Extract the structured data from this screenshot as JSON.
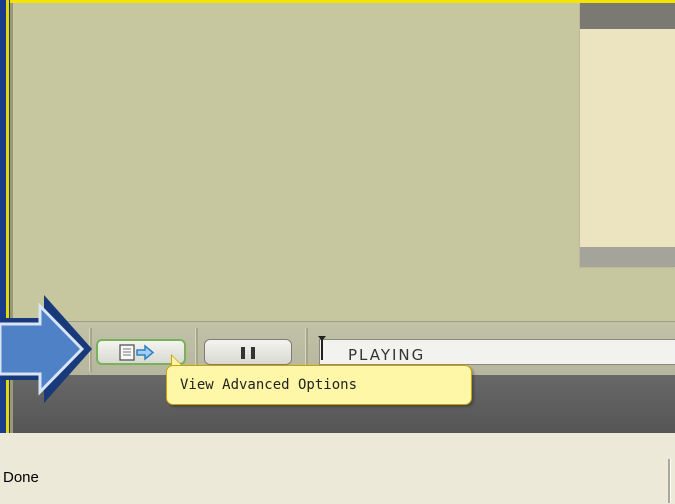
{
  "controlbar": {
    "advanced_button_tooltip": "View Advanced Options",
    "pause_button": "pause",
    "status_field": "PLAYING"
  },
  "statusbar": {
    "text": "Done"
  },
  "colors": {
    "tooltip_bg": "#fff7a8",
    "stage_bg": "#c6c79e",
    "accent_arrow": "#4f81c7",
    "highlight_border": "#79b15b"
  },
  "icons": {
    "advanced": "document-arrow-icon",
    "pause": "pause-icon",
    "pointer": "callout-arrow-icon"
  }
}
